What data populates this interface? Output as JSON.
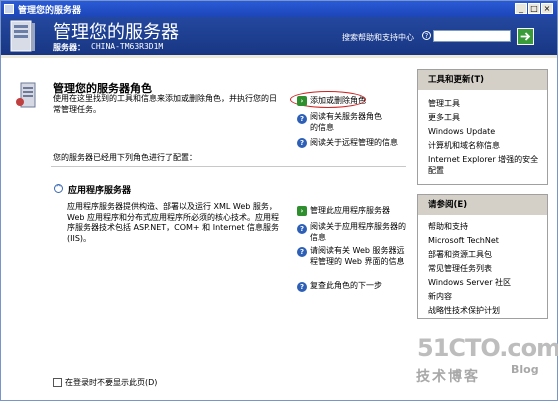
{
  "window": {
    "title": "管理您的服务器",
    "minimize": "_",
    "maximize": "□",
    "close": "×"
  },
  "header": {
    "title": "管理您的服务器",
    "server_label": "服务器：",
    "server_name": "CHINA-TM63R3D1M",
    "search_label": "搜索帮助和支持中心",
    "search_value": ""
  },
  "roles": {
    "title": "管理您的服务器角色",
    "description": "使用在这里找到的工具和信息来添加或删除角色，并执行您的日常管理任务。",
    "actions": [
      {
        "label": "添加或删除角色",
        "icon": "green-arrow-icon"
      },
      {
        "label": "阅读有关服务器角色的信息",
        "icon": "help-icon"
      },
      {
        "label": "阅读关于远程管理的信息",
        "icon": "help-icon"
      }
    ],
    "configured_text": "您的服务器已经用下列角色进行了配置："
  },
  "app_server": {
    "title": "应用程序服务器",
    "description": "应用程序服务器提供构造、部署以及运行 XML Web 服务，Web 应用程序和分布式应用程序所必须的核心技术。应用程序服务器技术包括 ASP.NET，COM+ 和 Internet 信息服务(IIS)。",
    "actions": [
      {
        "label": "管理此应用程序服务器",
        "icon": "green-arrow-icon"
      },
      {
        "label": "阅读关于应用程序服务器的信息",
        "icon": "help-icon"
      },
      {
        "label": "请阅读有关 Web 服务器远程管理的 Web 界面的信息",
        "icon": "help-icon"
      },
      {
        "label": "复查此角色的下一步",
        "icon": "help-icon"
      }
    ]
  },
  "footer": {
    "checkbox_label": "在登录时不要显示此页(D)",
    "checked": false
  },
  "tools_panel": {
    "title": "工具和更新(T)",
    "items": [
      "管理工具",
      "更多工具",
      "Windows Update",
      "计算机和域名称信息",
      "Internet Explorer 增强的安全配置"
    ]
  },
  "see_also_panel": {
    "title": "请参阅(E)",
    "items": [
      "帮助和支持",
      "Microsoft TechNet",
      "部署和资源工具包",
      "常见管理任务列表",
      "Windows Server 社区",
      "新内容",
      "战略性技术保护计划"
    ]
  },
  "watermark": {
    "main": "51CTO.com",
    "sub": "技术博客",
    "blog": "Blog"
  },
  "colors": {
    "header_bg": "#1d3d8f",
    "titlebar": "#2a5bd7",
    "panel_head": "#d4d0c8",
    "highlight": "#d02020"
  }
}
